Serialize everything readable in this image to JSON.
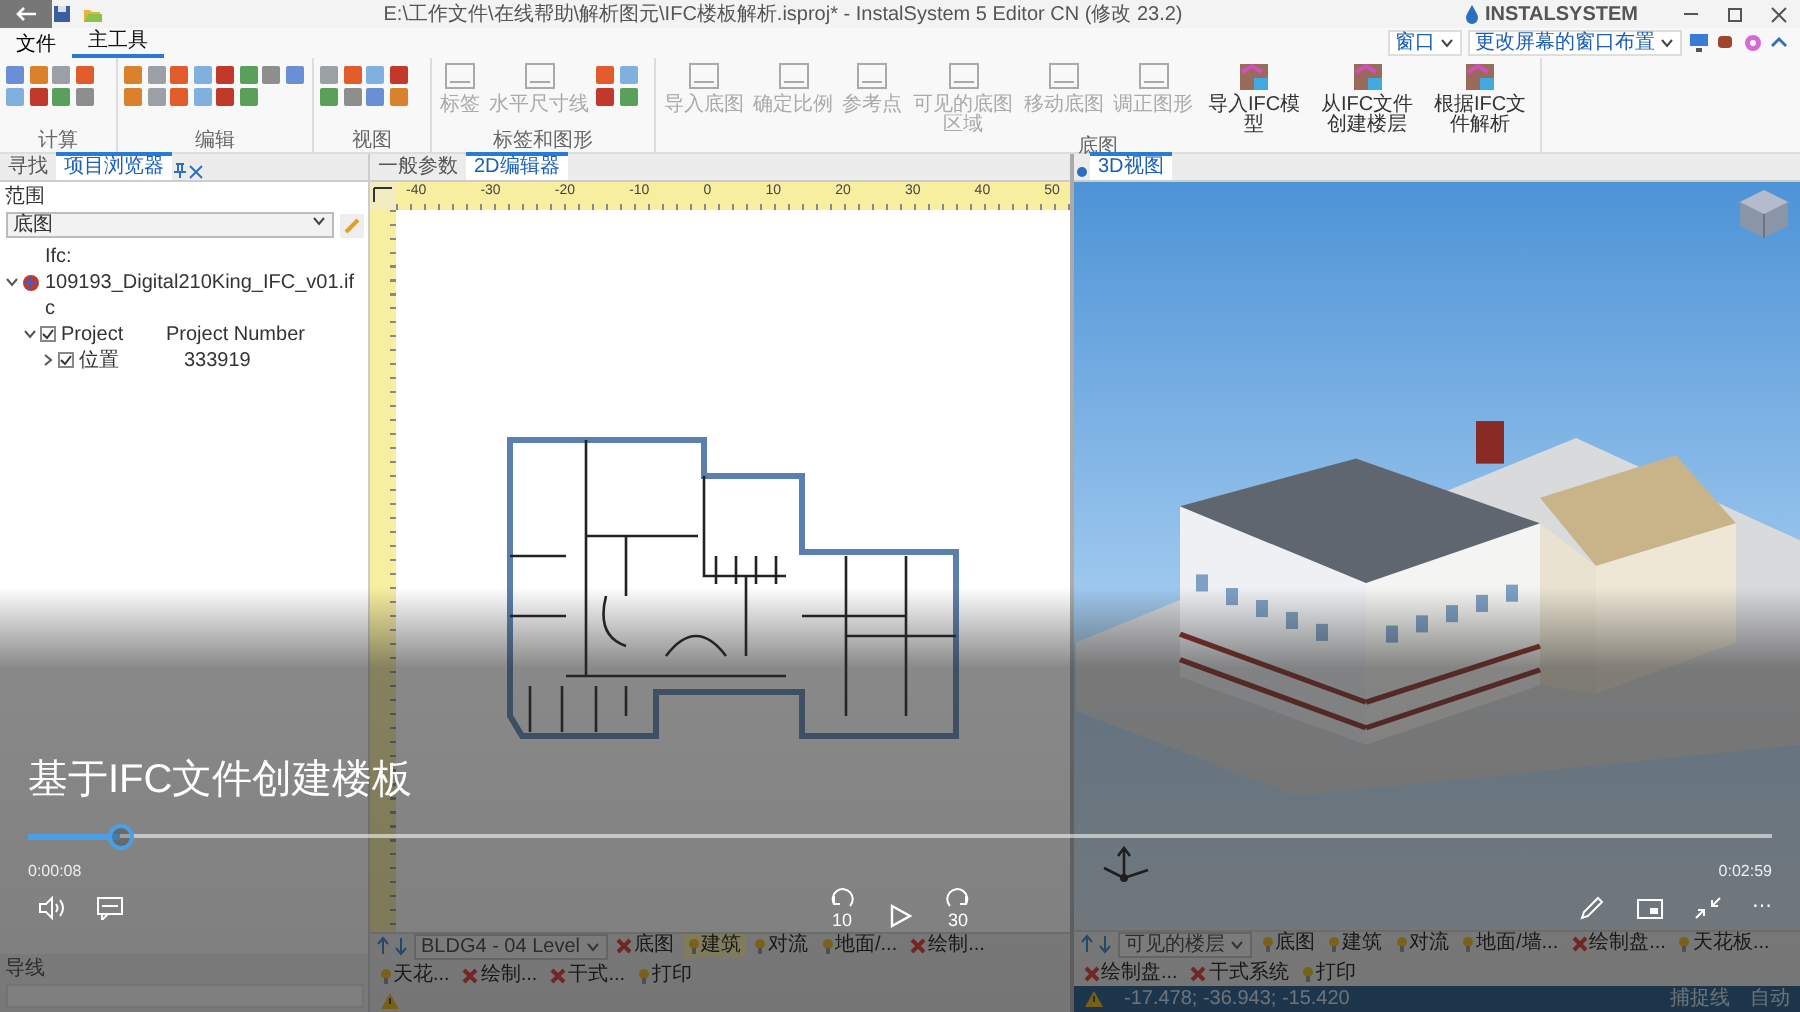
{
  "window": {
    "title": "E:\\工作文件\\在线帮助\\解析图元\\IFC楼板解析.isproj* - InstalSystem 5 Editor CN (修改 23.2)",
    "logo": "INSTALSYSTEM"
  },
  "ribbon_tabs": [
    {
      "label": "文件",
      "selected": false
    },
    {
      "label": "主工具",
      "selected": true
    }
  ],
  "ribbon_dropdowns": [
    "窗口",
    "更改屏幕的窗口布置"
  ],
  "ribbon_groups": [
    {
      "label": "计算",
      "kind": "icons"
    },
    {
      "label": "编辑",
      "kind": "icons"
    },
    {
      "label": "视图",
      "kind": "icons"
    },
    {
      "label": "标签和图形",
      "kind": "mixed",
      "buttons": [
        {
          "label": "标签",
          "disabled": true
        },
        {
          "label": "水平尺寸线",
          "disabled": true
        }
      ]
    },
    {
      "label": "底图",
      "kind": "large",
      "buttons": [
        {
          "label": "导入底图",
          "disabled": true
        },
        {
          "label": "确定比例",
          "disabled": true
        },
        {
          "label": "参考点",
          "disabled": true
        },
        {
          "label": "可见的底图区域",
          "disabled": true
        },
        {
          "label": "移动底图",
          "disabled": true
        },
        {
          "label": "调正图形",
          "disabled": true
        },
        {
          "label": "导入IFC模型",
          "disabled": false
        },
        {
          "label": "从IFC文件创建楼层",
          "disabled": false
        },
        {
          "label": "根据IFC文件解析",
          "disabled": false
        }
      ]
    }
  ],
  "left_panel": {
    "tabs": [
      {
        "label": "寻找",
        "selected": false
      },
      {
        "label": "项目浏览器",
        "selected": true
      }
    ],
    "scope_label": "范围",
    "scope_select": "底图",
    "tree": [
      {
        "label": "Ifc: 109193_Digital210King_IFC_v01.ifc",
        "expanded": true,
        "children": [
          {
            "label": "Project",
            "value": "Project Number",
            "checked": true,
            "expanded": true,
            "children": [
              {
                "label": "位置",
                "value": "333919",
                "checked": true,
                "expanded": false
              }
            ]
          }
        ]
      }
    ],
    "bottom_label": "导线"
  },
  "editor": {
    "tabs": [
      {
        "label": "一般参数",
        "selected": false
      },
      {
        "label": "2D编辑器",
        "selected": true
      }
    ],
    "ruler": [
      "-40",
      "-30",
      "-20",
      "-10",
      "0",
      "10",
      "20",
      "30",
      "40",
      "50"
    ],
    "floor_select": "BLDG4 - 04 Level",
    "layers": [
      {
        "label": "底图",
        "visible": false,
        "selected": false
      },
      {
        "label": "建筑",
        "visible": true,
        "selected": true
      },
      {
        "label": "对流",
        "visible": true,
        "selected": false
      },
      {
        "label": "地面/...",
        "visible": true,
        "selected": false
      },
      {
        "label": "绘制...",
        "visible": false,
        "selected": false
      },
      {
        "label": "天花...",
        "visible": true,
        "selected": false
      },
      {
        "label": "绘制...",
        "visible": false,
        "selected": false
      },
      {
        "label": "干式...",
        "visible": false,
        "selected": false
      },
      {
        "label": "打印",
        "visible": true,
        "selected": false
      }
    ]
  },
  "view3d": {
    "tab": "3D视图",
    "floor_select": "可见的楼层",
    "layers": [
      {
        "label": "底图",
        "visible": true,
        "selected": false
      },
      {
        "label": "建筑",
        "visible": true,
        "selected": false
      },
      {
        "label": "对流",
        "visible": true,
        "selected": false
      },
      {
        "label": "地面/墙...",
        "visible": true,
        "selected": false
      },
      {
        "label": "绘制盘...",
        "visible": false,
        "selected": false
      },
      {
        "label": "天花板...",
        "visible": true,
        "selected": false
      },
      {
        "label": "绘制盘...",
        "visible": false,
        "selected": false
      },
      {
        "label": "干式系统",
        "visible": false,
        "selected": false
      },
      {
        "label": "打印",
        "visible": true,
        "selected": false
      }
    ],
    "coordinates": "-17.478; -36.943; -15.420",
    "toggles": [
      "捕捉线",
      "自动"
    ]
  },
  "video": {
    "title": "基于IFC文件创建楼板",
    "level": 0.053,
    "elapsed": "0:00:08",
    "duration": "0:02:59",
    "rewind": "10",
    "forward": "30",
    "more": "⋯"
  }
}
